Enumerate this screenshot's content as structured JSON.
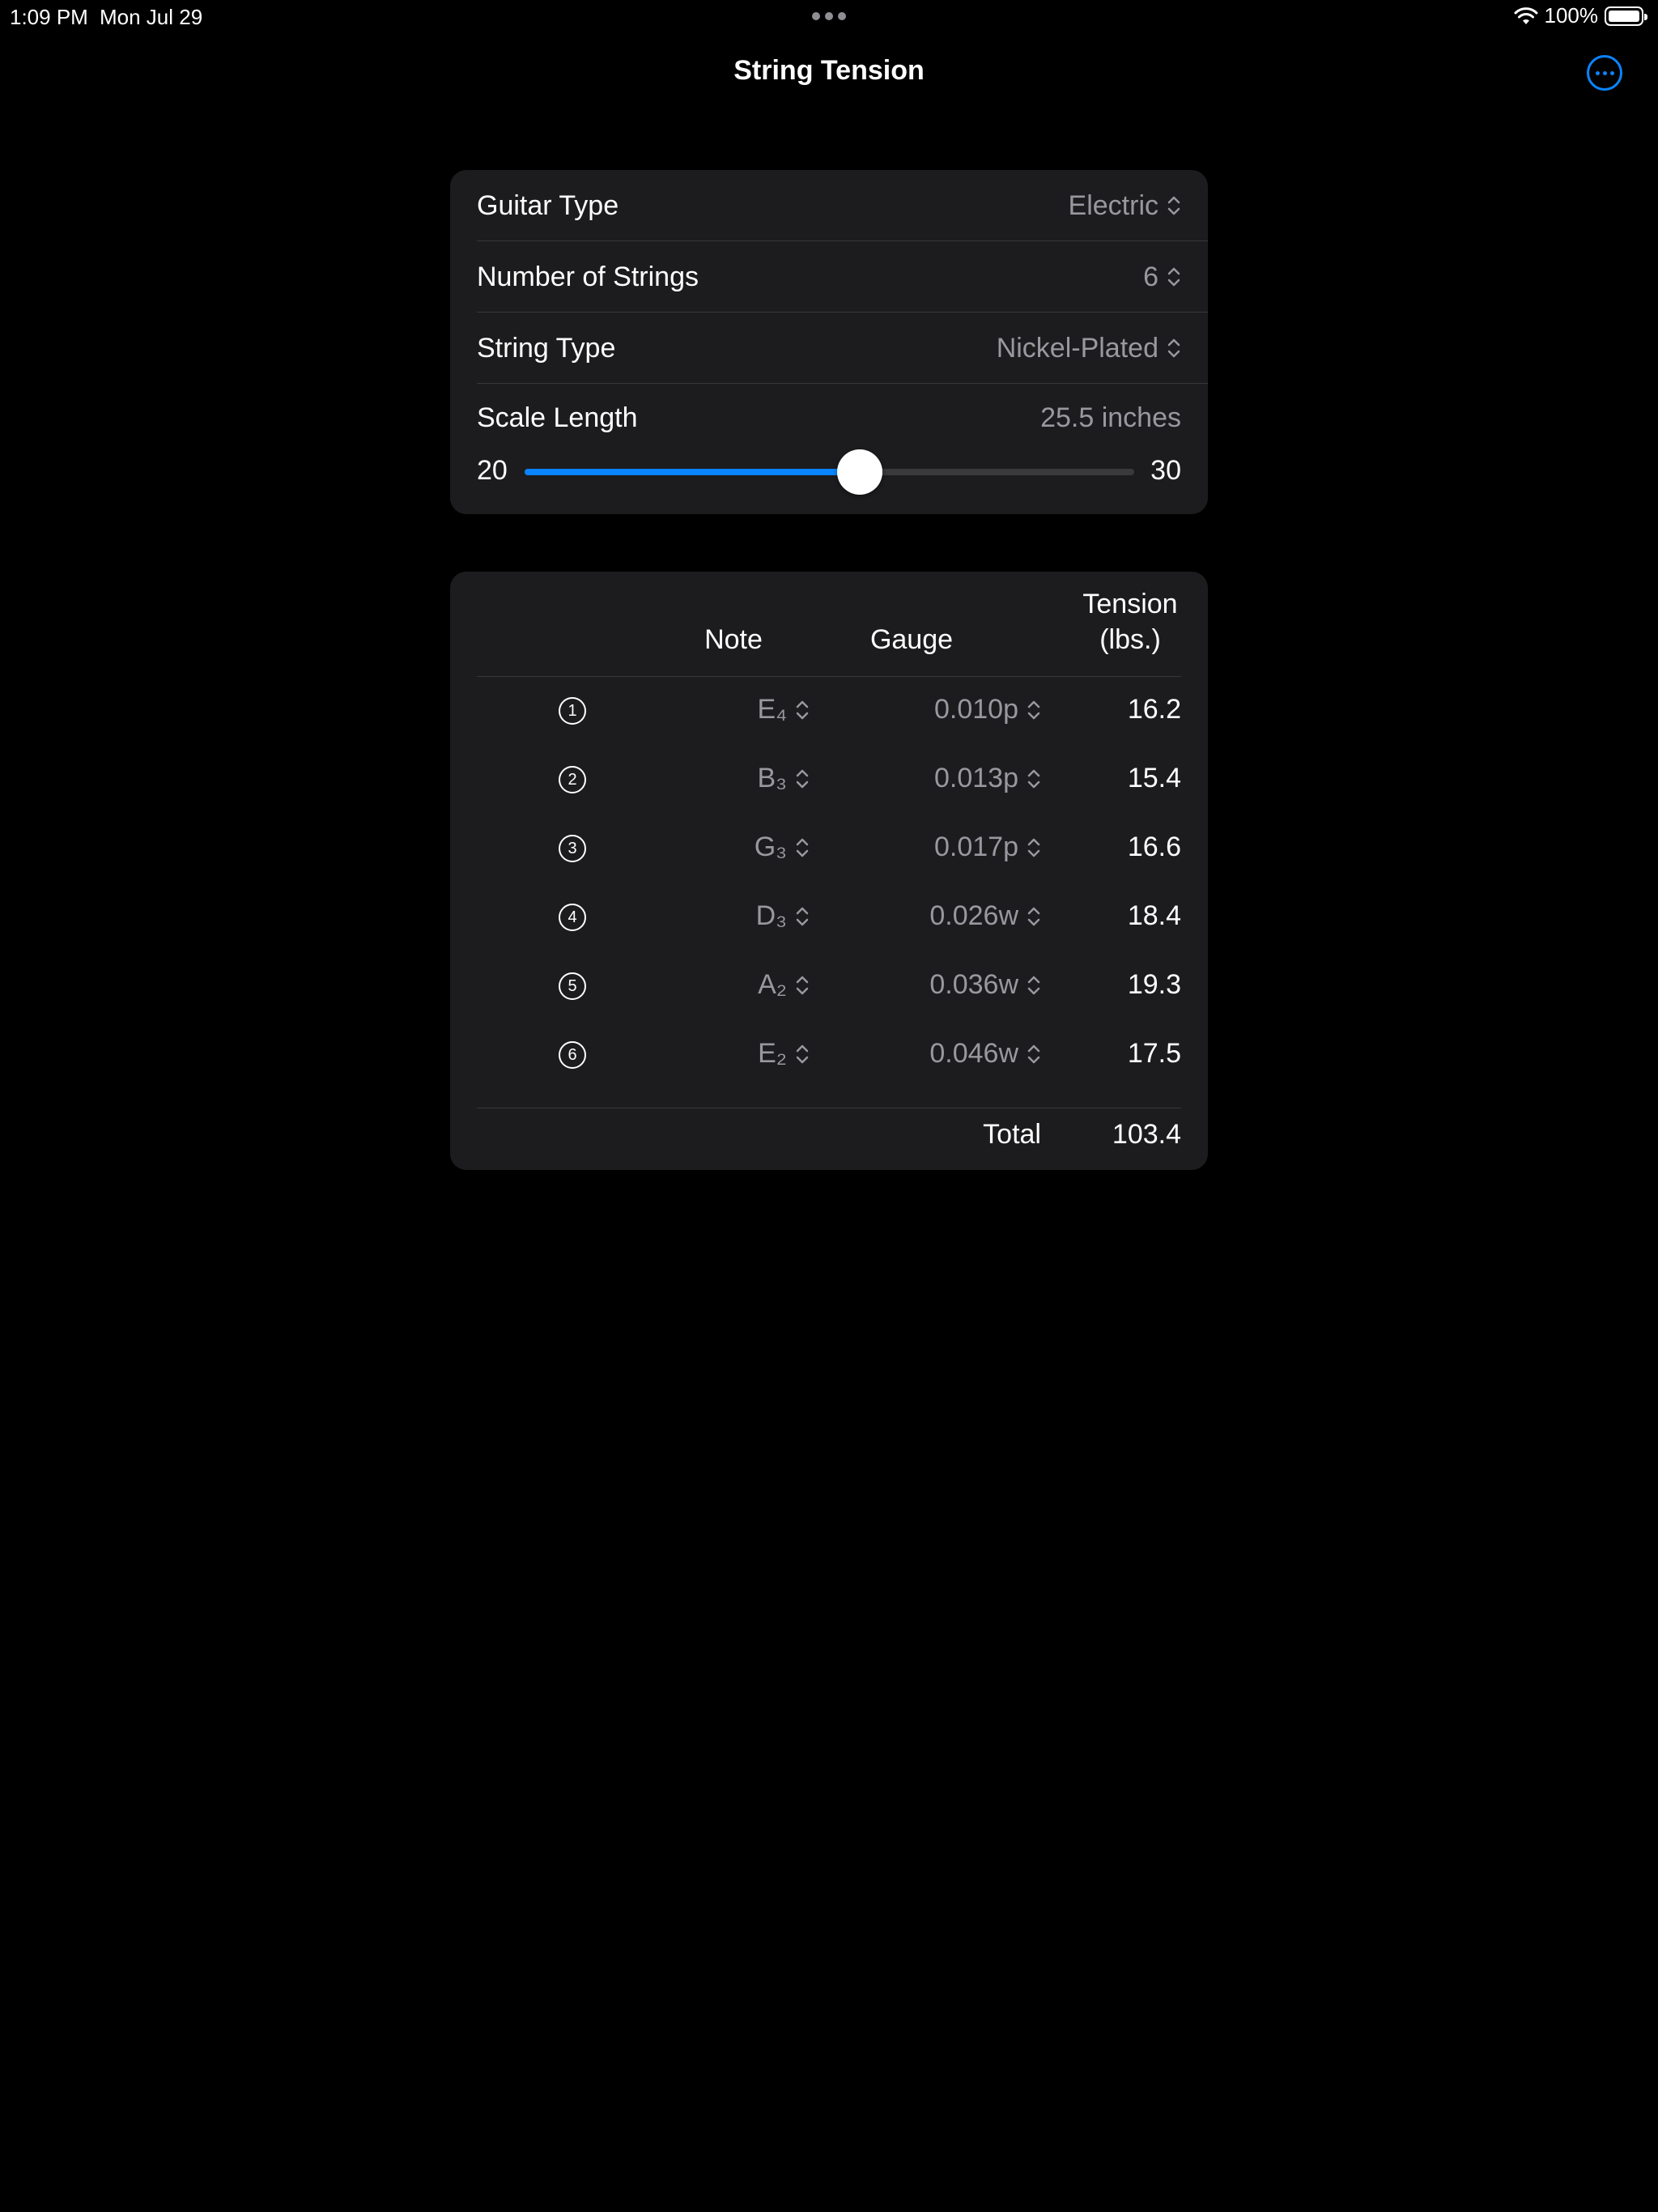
{
  "status": {
    "time": "1:09 PM",
    "date": "Mon Jul 29",
    "battery": "100%"
  },
  "nav": {
    "title": "String Tension",
    "more_icon": "ellipsis-circle-icon"
  },
  "settings": {
    "guitar_type": {
      "label": "Guitar Type",
      "value": "Electric"
    },
    "num_strings": {
      "label": "Number of Strings",
      "value": "6"
    },
    "string_type": {
      "label": "String Type",
      "value": "Nickel-Plated"
    },
    "scale": {
      "label": "Scale Length",
      "value_text": "25.5 inches",
      "min": "20",
      "max": "30",
      "value": 25.5
    }
  },
  "table": {
    "headers": {
      "note": "Note",
      "gauge": "Gauge",
      "tension_line1": "Tension",
      "tension_line2": "(lbs.)"
    },
    "rows": [
      {
        "num": "1",
        "note": "E₄",
        "gauge": "0.010p",
        "tension": "16.2"
      },
      {
        "num": "2",
        "note": "B₃",
        "gauge": "0.013p",
        "tension": "15.4"
      },
      {
        "num": "3",
        "note": "G₃",
        "gauge": "0.017p",
        "tension": "16.6"
      },
      {
        "num": "4",
        "note": "D₃",
        "gauge": "0.026w",
        "tension": "18.4"
      },
      {
        "num": "5",
        "note": "A₂",
        "gauge": "0.036w",
        "tension": "19.3"
      },
      {
        "num": "6",
        "note": "E₂",
        "gauge": "0.046w",
        "tension": "17.5"
      }
    ],
    "total_label": "Total",
    "total_value": "103.4"
  },
  "colors": {
    "accent": "#0a84ff",
    "card": "#1c1c1e",
    "secondary_text": "#98989f"
  }
}
